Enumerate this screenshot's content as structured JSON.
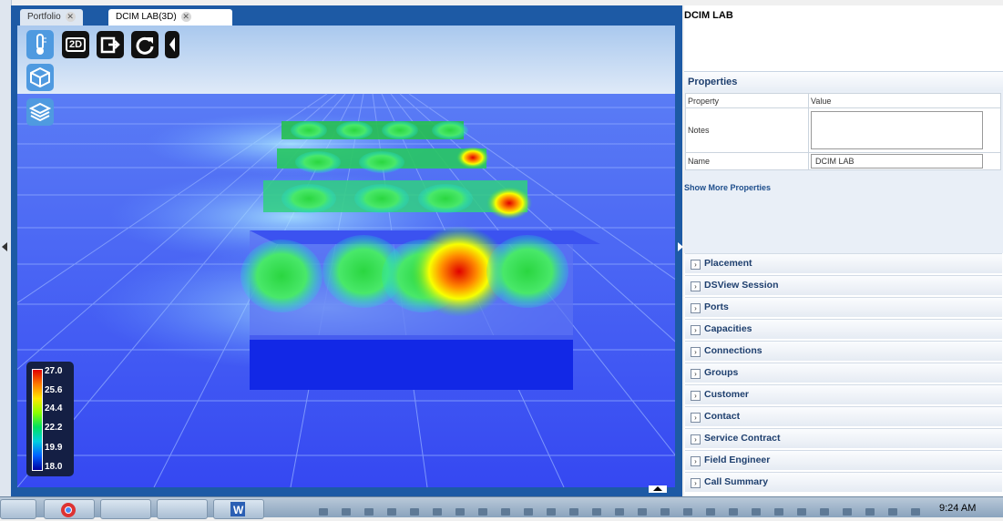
{
  "tabs": [
    {
      "label": "Portfolio",
      "close": "✕",
      "active": false
    },
    {
      "label": "DCIM LAB(3D)",
      "close": "✕",
      "active": true
    }
  ],
  "toolbar": {
    "thermometer_icon": "thermometer-icon",
    "view2d_label": "2D",
    "export_icon": "export-icon",
    "refresh_icon": "refresh-icon",
    "collapse_icon": "chevron-left-icon",
    "cube_icon": "cube-icon",
    "layers_icon": "layers-icon"
  },
  "legend": {
    "values": [
      "27.0",
      "25.6",
      "24.4",
      "22.2",
      "19.9",
      "18.0"
    ]
  },
  "right_panel": {
    "title": "DCIM LAB",
    "properties_header": "Properties",
    "columns": [
      "Property",
      "Value"
    ],
    "rows": [
      {
        "property": "Notes",
        "value": ""
      },
      {
        "property": "Name",
        "value": "DCIM LAB"
      }
    ],
    "show_more": "Show More Properties",
    "sections": [
      "Placement",
      "DSView Session",
      "Ports",
      "Capacities",
      "Connections",
      "Groups",
      "Customer",
      "Contact",
      "Service Contract",
      "Field Engineer",
      "Call Summary"
    ]
  },
  "taskbar": {
    "clock": "9:24 AM"
  },
  "colors": {
    "accent": "#1d5aa5",
    "floor": "#2f3ff0",
    "hot": "#e00000",
    "cool": "#00d060"
  }
}
